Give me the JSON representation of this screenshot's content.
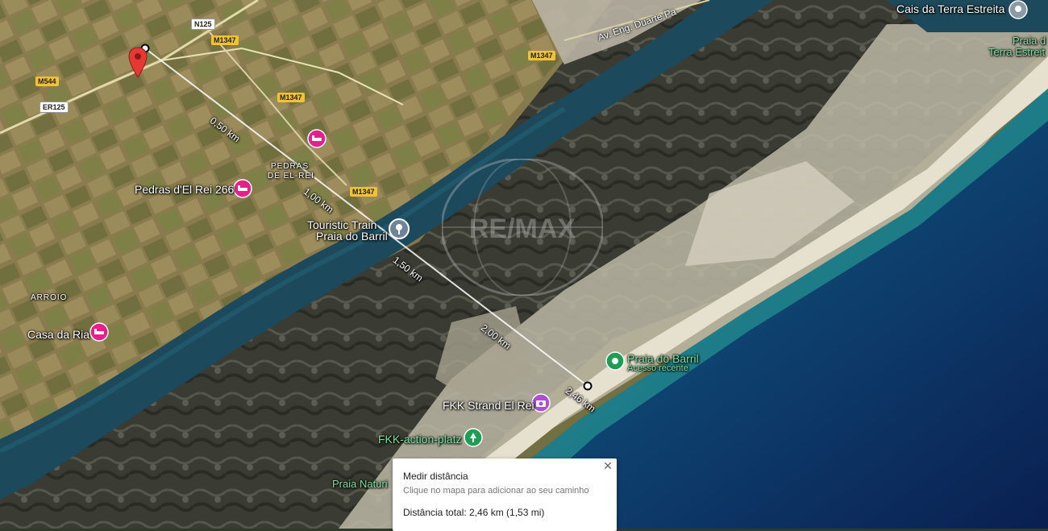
{
  "places": {
    "cais": "Cais da Terra Estreita",
    "praia_terra_1": "Praia d",
    "praia_terra_2": "Terra Estreit",
    "pedras_1": "PEDRAS",
    "pedras_2": "DE EL-REI",
    "pedras266": "Pedras d'El Rei 266",
    "train_1": "Touristic Train",
    "train_2": "Praia do Barril",
    "arroio": "ARROIO",
    "casa": "Casa da Ria",
    "barril": "Praia do Barril",
    "barril_sub": "Acesso recente",
    "fkk_strand": "FKK Strand El Rei",
    "fkk_action": "FKK-action-platz",
    "praia_natur": "Praia Naturi"
  },
  "roads": {
    "n125": "N125",
    "m1347_a": "M1347",
    "m1347_b": "M1347",
    "m1347_c": "M1347",
    "m1347_d": "M1347",
    "m544": "M544",
    "er125": "ER125",
    "av": "Av. Eng. Duarte Pa"
  },
  "distances": [
    "0,50 km",
    "1,00 km",
    "1,50 km",
    "2,00 km",
    "2,46 km"
  ],
  "watermark": "RE/MAX",
  "panel": {
    "title": "Medir distância",
    "subtitle": "Clique no mapa para adicionar ao seu caminho",
    "total": "Distância total: 2,46 km (1,53 mi)",
    "close": "✕"
  },
  "colors": {
    "red_pin": "#e53935",
    "lodging_pin": "#e91e8c",
    "green_pin": "#1e9e55",
    "grey_pin": "#6f8496",
    "measure_line": "#ffffff"
  }
}
